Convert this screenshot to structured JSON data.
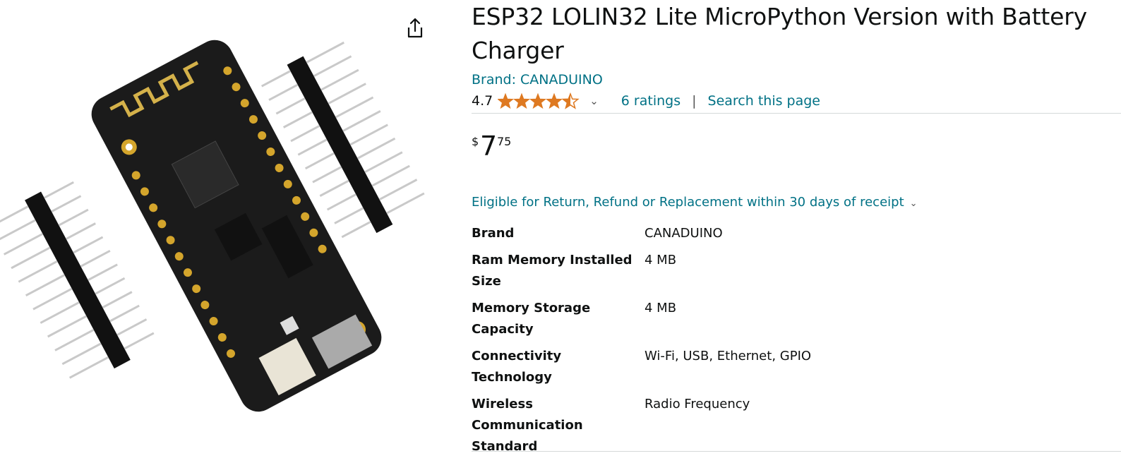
{
  "product": {
    "title": "ESP32 LOLIN32 Lite MicroPython Version with Battery Charger",
    "brand_link": "Brand: CANADUINO",
    "rating": "4.7",
    "rating_stars": 4.7,
    "ratings_link": "6 ratings",
    "separator": "|",
    "search_link": "Search this page"
  },
  "price": {
    "symbol": "$",
    "whole": "7",
    "fraction": "75"
  },
  "returns": {
    "text": "Eligible for Return, Refund or Replacement within 30 days of receipt"
  },
  "specs": [
    {
      "key": "Brand",
      "value": "CANADUINO"
    },
    {
      "key": "Ram Memory Installed Size",
      "value": "4 MB"
    },
    {
      "key": "Memory Storage Capacity",
      "value": "4 MB"
    },
    {
      "key": "Connectivity Technology",
      "value": "Wi-Fi, USB, Ethernet, GPIO"
    },
    {
      "key": "Wireless Communication Standard",
      "value": "Radio Frequency"
    }
  ],
  "icons": {
    "share": "share-icon",
    "star": "star-icon",
    "chevron": "chevron-down-icon"
  },
  "colors": {
    "link": "#007185",
    "star": "#de7921",
    "text": "#0f1111"
  }
}
